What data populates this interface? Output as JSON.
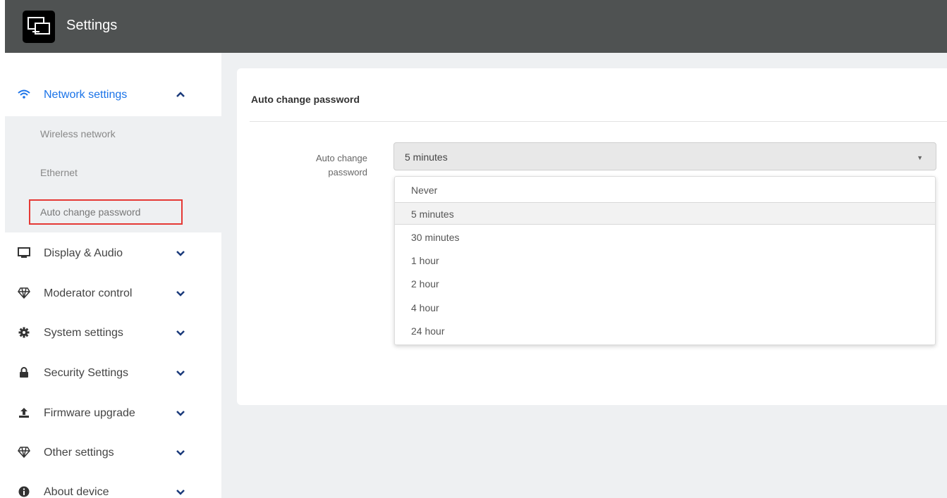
{
  "header": {
    "title": "Settings",
    "logo_icon": "screen-cast-icon"
  },
  "sidebar": {
    "sections": [
      {
        "label": "Network settings",
        "icon": "wifi-icon",
        "expanded": true,
        "active": true
      },
      {
        "label": "Display & Audio",
        "icon": "monitor-icon",
        "expanded": false
      },
      {
        "label": "Moderator control",
        "icon": "diamond-icon",
        "expanded": false
      },
      {
        "label": "System settings",
        "icon": "gear-icon",
        "expanded": false
      },
      {
        "label": "Security Settings",
        "icon": "lock-icon",
        "expanded": false
      },
      {
        "label": "Firmware upgrade",
        "icon": "upload-icon",
        "expanded": false
      },
      {
        "label": "Other settings",
        "icon": "diamond-icon",
        "expanded": false
      },
      {
        "label": "About device",
        "icon": "info-icon",
        "expanded": false
      }
    ],
    "network_subitems": [
      {
        "label": "Wireless network"
      },
      {
        "label": "Ethernet"
      },
      {
        "label": "Auto change password",
        "selected": true
      }
    ]
  },
  "main": {
    "card_title": "Auto change password",
    "field_label": "Auto change password",
    "select": {
      "value": "5 minutes",
      "options": [
        "Never",
        "5 minutes",
        "30 minutes",
        "1 hour",
        "2 hour",
        "4 hour",
        "24 hour"
      ],
      "highlighted": "5 minutes"
    }
  },
  "colors": {
    "topbar": "#4f5252",
    "accent": "#1a73e8",
    "highlight_box": "#e53935",
    "panel_bg": "#eef0f2"
  }
}
